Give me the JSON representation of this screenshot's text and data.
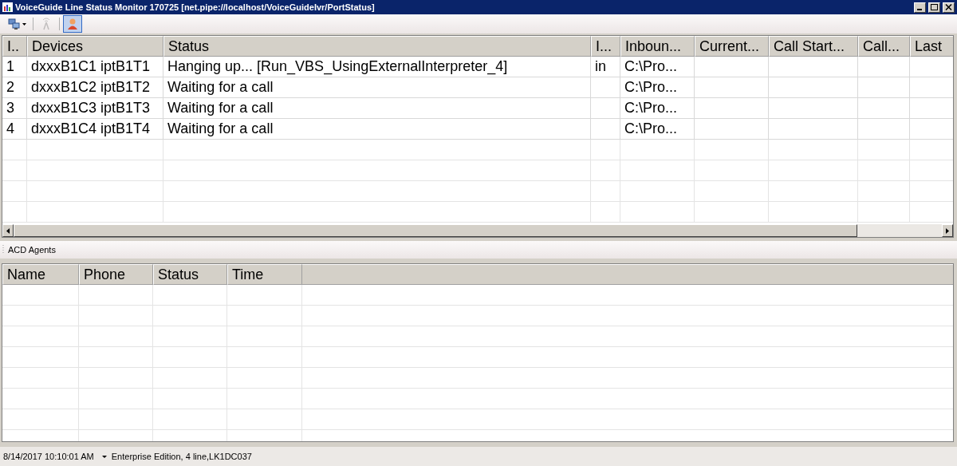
{
  "window": {
    "title": "VoiceGuide Line Status Monitor 170725 [net.pipe://localhost/VoiceGuideIvr/PortStatus]"
  },
  "toolbar": [
    {
      "kind": "computers",
      "dropdown": true,
      "disabled": false,
      "pressed": false
    },
    {
      "kind": "antenna",
      "dropdown": false,
      "disabled": true,
      "pressed": false
    },
    {
      "kind": "person",
      "dropdown": false,
      "disabled": false,
      "pressed": true
    }
  ],
  "lines_table": {
    "columns": [
      "I..",
      "Devices",
      "Status",
      "I...",
      "Inboun...",
      "Current...",
      "Call Start...",
      "Call...",
      "Last"
    ],
    "rows": [
      [
        "1",
        "dxxxB1C1 iptB1T1",
        "Hanging up... [Run_VBS_UsingExternalInterpreter_4]",
        "in",
        "C:\\Pro...",
        "",
        "",
        "",
        ""
      ],
      [
        "2",
        "dxxxB1C2 iptB1T2",
        "Waiting for a call",
        "",
        "C:\\Pro...",
        "",
        "",
        "",
        ""
      ],
      [
        "3",
        "dxxxB1C3 iptB1T3",
        "Waiting for a call",
        "",
        "C:\\Pro...",
        "",
        "",
        "",
        ""
      ],
      [
        "4",
        "dxxxB1C4 iptB1T4",
        "Waiting for a call",
        "",
        "C:\\Pro...",
        "",
        "",
        "",
        ""
      ]
    ]
  },
  "agents_panel": {
    "title": "ACD Agents",
    "columns": [
      "Name",
      "Phone",
      "Status",
      "Time"
    ]
  },
  "status_bar": {
    "time": "8/14/2017 10:10:01 AM",
    "edition": "Enterprise Edition, 4 line,LK1DC037"
  }
}
